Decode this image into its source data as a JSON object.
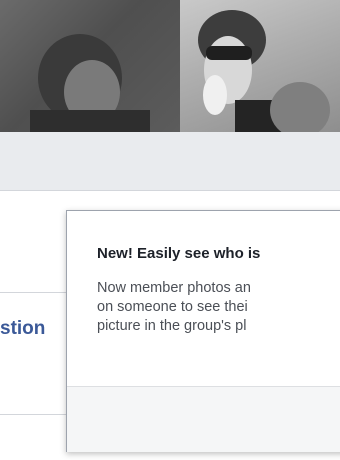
{
  "sidebar": {
    "link_label": "stion"
  },
  "tooltip": {
    "title": "New! Easily see who is",
    "body_lines": [
      "Now member photos an",
      "on someone to see thei",
      "picture in the group's pl"
    ]
  },
  "colors": {
    "link": "#3b5998",
    "strip": "#e9ebee",
    "footer": "#f5f6f7"
  }
}
